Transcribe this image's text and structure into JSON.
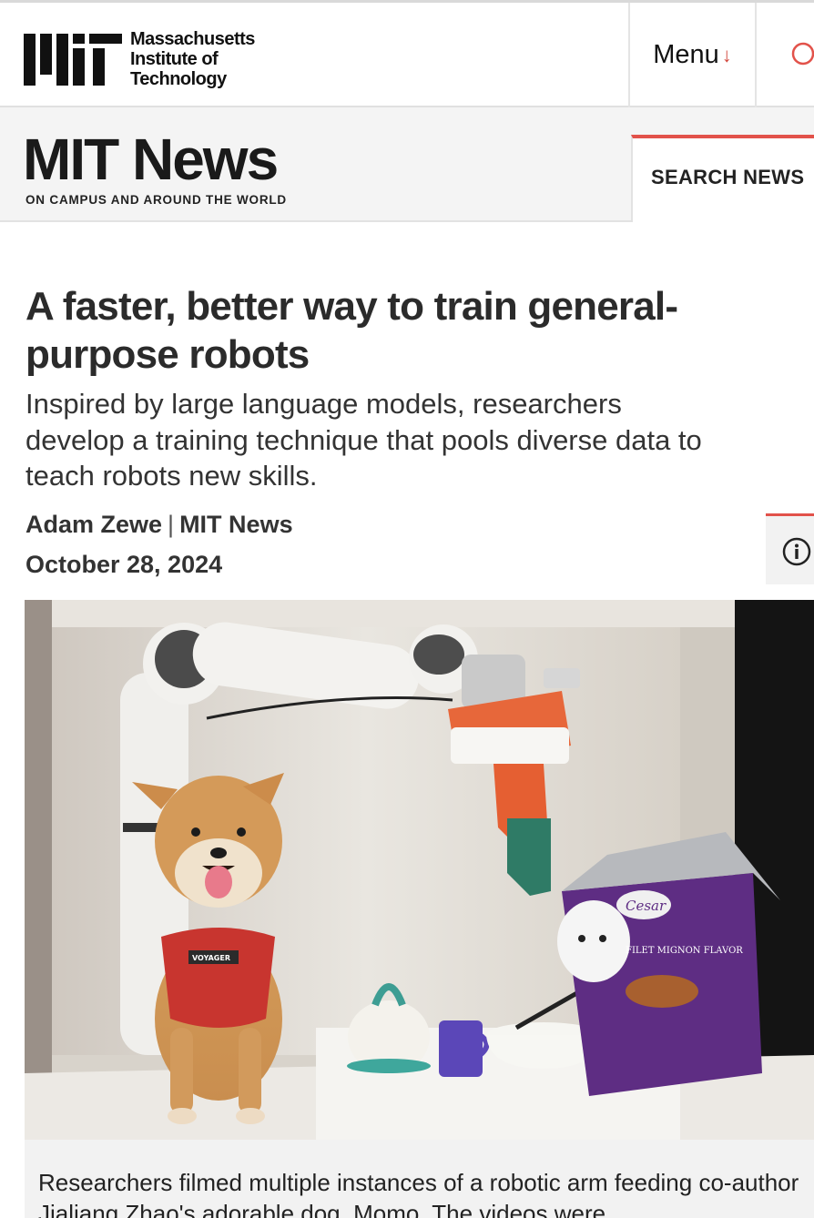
{
  "header": {
    "institute_name": "Massachusetts\nInstitute of\nTechnology",
    "logo_icon": "mit-logo",
    "menu_label": "Menu",
    "menu_icon": "arrow-down-icon",
    "search_icon": "search-icon",
    "accent_color": "#e2524a"
  },
  "news_header": {
    "title": "MIT News",
    "tagline": "ON CAMPUS AND AROUND THE WORLD",
    "search_label": "SEARCH NEWS"
  },
  "article": {
    "headline": "A faster, better way to train general-purpose robots",
    "dek": "Inspired by large language models, researchers\ndevelop a training technique that pools diverse data to\nteach robots new skills.",
    "author": "Adam Zewe",
    "source": "MIT News",
    "date": "October 28, 2024",
    "info_icon": "info-icon",
    "image": {
      "visible_labels": [
        "VOYAGER",
        "Cesar",
        "FILET MIGNON FLAVOR"
      ]
    },
    "caption": "Researchers filmed multiple instances of a robotic arm feeding co-author Jialiang Zhao's adorable dog, Momo. The videos were"
  }
}
